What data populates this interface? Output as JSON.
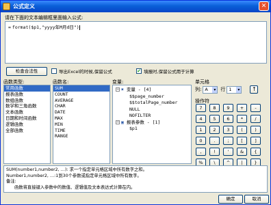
{
  "window": {
    "title": "公式定义",
    "close_label": "✕"
  },
  "prompt": "请在下面的文本编辑框里面输入公式:",
  "editor": {
    "prefix": "=",
    "formula": "format($p1,\"yyyy年M月d日\")"
  },
  "check_button": "检查合法性",
  "options": [
    {
      "label": "导出Excel的时候,保留公式",
      "checked": false
    },
    {
      "label": "填报时,保留公式用于计算",
      "checked": true
    }
  ],
  "category_panel": {
    "label": "函数类型:",
    "items": [
      "常用函数",
      "报表函数",
      "数组函数",
      "数学和三角函数",
      "文本函数",
      "日期和时间函数",
      "逻辑函数",
      "全部函数"
    ],
    "selected": 0
  },
  "function_panel": {
    "label": "函数名:",
    "items": [
      "SUM",
      "COUNT",
      "AVERAGE",
      "CHAR",
      "DATE",
      "MAX",
      "MIN",
      "TIME",
      "RANGE"
    ],
    "selected": 0
  },
  "variable_panel": {
    "label": "变量:",
    "root1": "变量 - [4]",
    "vars": [
      "$$page_number",
      "$$totalPage_number",
      "NULL",
      "NOFILTER"
    ],
    "root2": "报表参数 - [1]",
    "params": [
      "$p1"
    ]
  },
  "cell_panel": {
    "label": "单元格",
    "col_label": "列:",
    "col_value": "A",
    "row_label": "行",
    "row_value": "1",
    "up_label": "↑",
    "operator_label": "操作符",
    "keys": [
      "7",
      "8",
      "9",
      "+",
      "-",
      "4",
      "5",
      "6",
      "*",
      "/",
      "1",
      "2",
      "3",
      "(",
      ")",
      "0",
      ".",
      ";",
      "[",
      "]",
      ",",
      "!",
      "'",
      "&",
      "{",
      "%",
      "\\",
      "^",
      "|",
      "}",
      "<",
      ">",
      "=",
      "<=",
      ">=",
      "<>",
      "?",
      ":",
      "\"",
      "$"
    ]
  },
  "description": [
    "SUM(number1,number2, …): 求一个指定单元格区域中所有数字之和。",
    "Number1,number2, …:1到30个参数或指定单元格区域中所有数字。",
    "备注:",
    "函数将直接键入参数中的数值、逻辑值及文本表达式计算在内。"
  ],
  "buttons": {
    "ok": "确定",
    "cancel": "取消"
  }
}
